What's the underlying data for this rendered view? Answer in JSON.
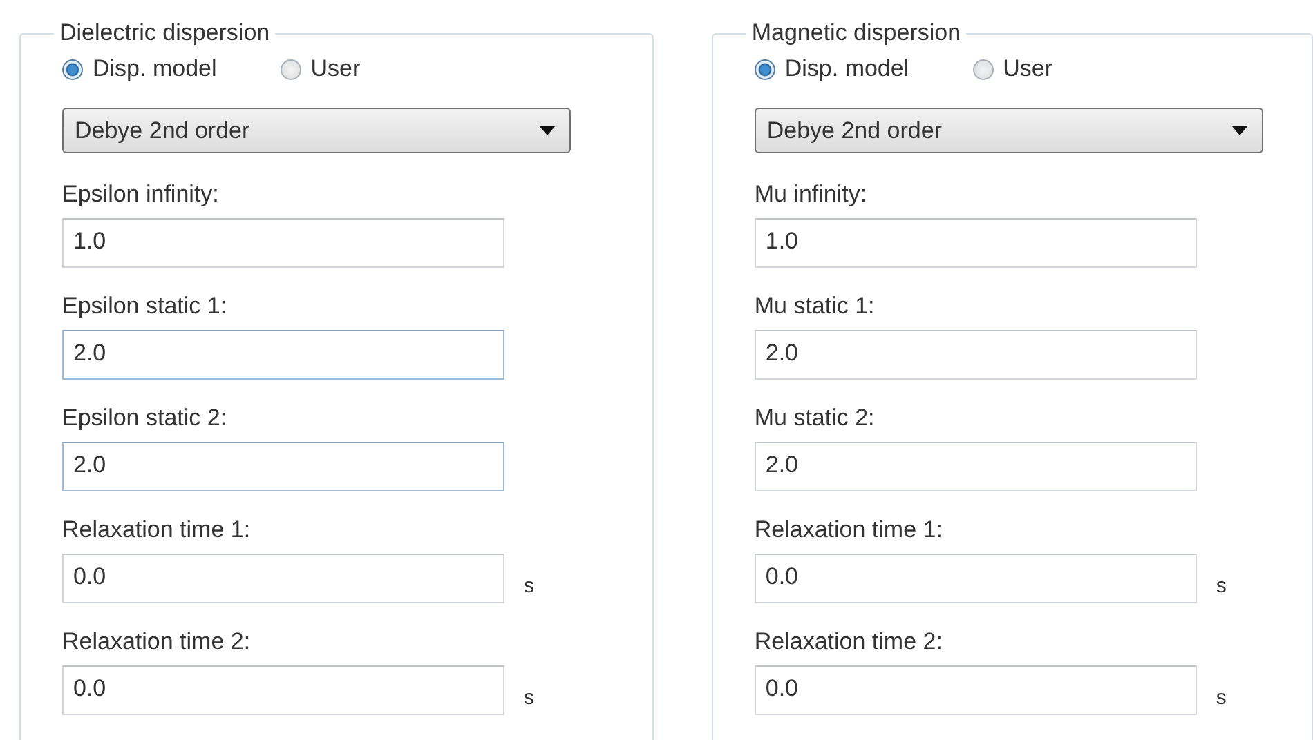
{
  "groups": [
    {
      "title": "Dielectric dispersion",
      "options": [
        {
          "label": "Disp. model",
          "selected": true
        },
        {
          "label": "User",
          "selected": false
        }
      ],
      "model": "Debye 2nd order",
      "fields": [
        {
          "label": "Epsilon infinity:",
          "value": "1.0",
          "highlighted": false
        },
        {
          "label": "Epsilon static 1:",
          "value": "2.0",
          "highlighted": true
        },
        {
          "label": "Epsilon static 2:",
          "value": "2.0",
          "highlighted": true
        },
        {
          "label": "Relaxation time 1:",
          "value": "0.0",
          "unit": "s",
          "highlighted": false
        },
        {
          "label": "Relaxation time 2:",
          "value": "0.0",
          "unit": "s",
          "highlighted": false
        }
      ]
    },
    {
      "title": "Magnetic dispersion",
      "options": [
        {
          "label": "Disp. model",
          "selected": true
        },
        {
          "label": "User",
          "selected": false
        }
      ],
      "model": "Debye 2nd order",
      "fields": [
        {
          "label": "Mu infinity:",
          "value": "1.0",
          "highlighted": false
        },
        {
          "label": "Mu static 1:",
          "value": "2.0",
          "highlighted": false
        },
        {
          "label": "Mu static 2:",
          "value": "2.0",
          "highlighted": false
        },
        {
          "label": "Relaxation time 1:",
          "value": "0.0",
          "unit": "s",
          "highlighted": false
        },
        {
          "label": "Relaxation time 2:",
          "value": "0.0",
          "unit": "s",
          "highlighted": false
        }
      ]
    }
  ]
}
